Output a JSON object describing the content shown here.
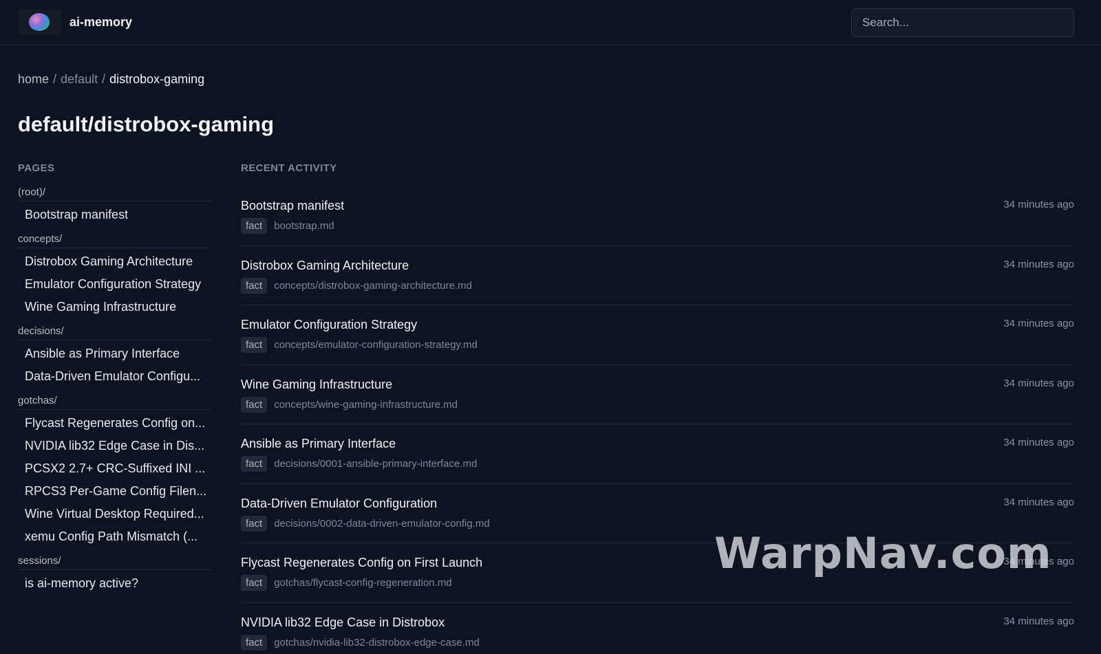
{
  "header": {
    "app_name": "ai-memory",
    "logo_icon": "brain-orb-icon",
    "search_placeholder": "Search..."
  },
  "breadcrumb": {
    "home": "home",
    "separator": "/",
    "namespace": "default",
    "current": "distrobox-gaming"
  },
  "page_title": "default/distrobox-gaming",
  "sidebar": {
    "heading": "PAGES",
    "groups": [
      {
        "label": "(root)/",
        "items": [
          "Bootstrap manifest"
        ]
      },
      {
        "label": "concepts/",
        "items": [
          "Distrobox Gaming Architecture",
          "Emulator Configuration Strategy",
          "Wine Gaming Infrastructure"
        ]
      },
      {
        "label": "decisions/",
        "items": [
          "Ansible as Primary Interface",
          "Data-Driven Emulator Configu..."
        ]
      },
      {
        "label": "gotchas/",
        "items": [
          "Flycast Regenerates Config on...",
          "NVIDIA lib32 Edge Case in Dis...",
          "PCSX2 2.7+ CRC-Suffixed INI ...",
          "RPCS3 Per-Game Config Filen...",
          "Wine Virtual Desktop Required...",
          "xemu Config Path Mismatch (..."
        ]
      },
      {
        "label": "sessions/",
        "items": [
          "is ai-memory active?"
        ]
      }
    ]
  },
  "activity": {
    "heading": "RECENT ACTIVITY",
    "items": [
      {
        "title": "Bootstrap manifest",
        "tag": "fact",
        "path": "bootstrap.md",
        "time": "34 minutes ago"
      },
      {
        "title": "Distrobox Gaming Architecture",
        "tag": "fact",
        "path": "concepts/distrobox-gaming-architecture.md",
        "time": "34 minutes ago"
      },
      {
        "title": "Emulator Configuration Strategy",
        "tag": "fact",
        "path": "concepts/emulator-configuration-strategy.md",
        "time": "34 minutes ago"
      },
      {
        "title": "Wine Gaming Infrastructure",
        "tag": "fact",
        "path": "concepts/wine-gaming-infrastructure.md",
        "time": "34 minutes ago"
      },
      {
        "title": "Ansible as Primary Interface",
        "tag": "fact",
        "path": "decisions/0001-ansible-primary-interface.md",
        "time": "34 minutes ago"
      },
      {
        "title": "Data-Driven Emulator Configuration",
        "tag": "fact",
        "path": "decisions/0002-data-driven-emulator-config.md",
        "time": "34 minutes ago"
      },
      {
        "title": "Flycast Regenerates Config on First Launch",
        "tag": "fact",
        "path": "gotchas/flycast-config-regeneration.md",
        "time": "34 minutes ago"
      },
      {
        "title": "NVIDIA lib32 Edge Case in Distrobox",
        "tag": "fact",
        "path": "gotchas/nvidia-lib32-distrobox-edge-case.md",
        "time": "34 minutes ago"
      }
    ]
  },
  "watermark": "WarpNav.com"
}
